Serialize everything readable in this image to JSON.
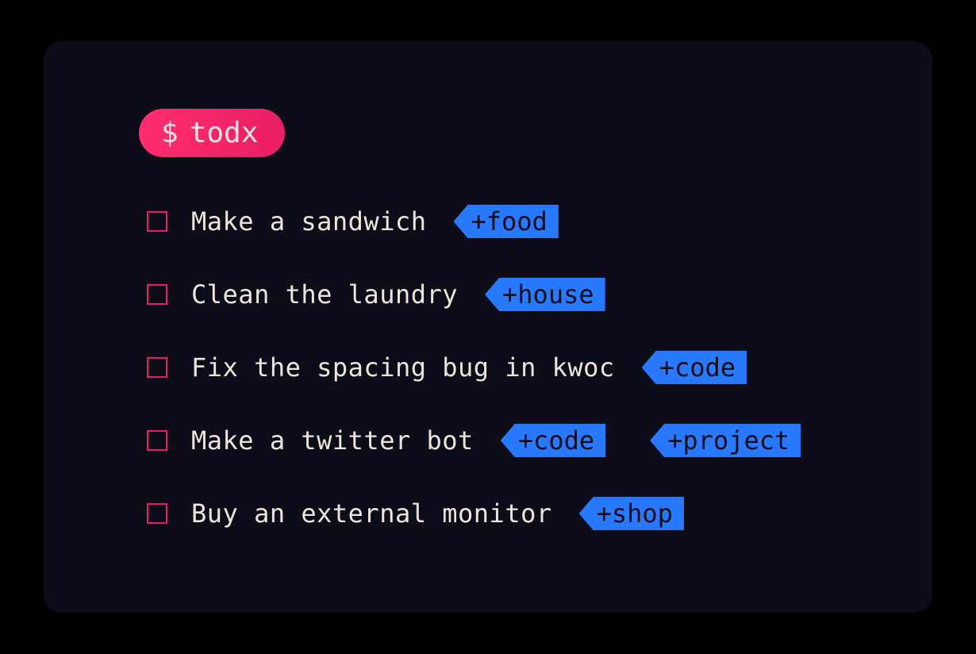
{
  "prompt": {
    "symbol": "$",
    "command": "todx"
  },
  "todos": [
    {
      "text": "Make a sandwich",
      "tags": [
        "+food"
      ]
    },
    {
      "text": "Clean the laundry",
      "tags": [
        "+house"
      ]
    },
    {
      "text": "Fix the spacing bug in kwoc",
      "tags": [
        "+code"
      ]
    },
    {
      "text": "Make a twitter bot",
      "tags": [
        "+code",
        "+project"
      ]
    },
    {
      "text": "Buy an external monitor",
      "tags": [
        "+shop"
      ]
    }
  ],
  "colors": {
    "background": "#0d0d1a",
    "badge_gradient_start": "#ff2d6f",
    "badge_gradient_end": "#e91e63",
    "checkbox_border": "#e91e63",
    "text": "#ede4dc",
    "tag_bg": "#2979ff",
    "tag_text": "#0d0d1a"
  }
}
